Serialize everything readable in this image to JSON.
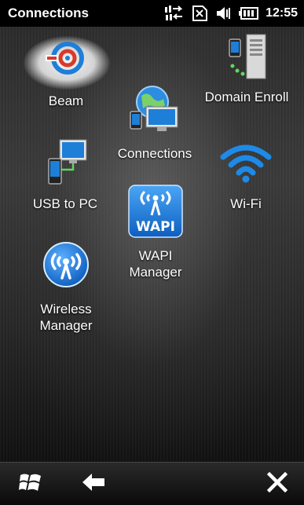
{
  "status_bar": {
    "title": "Connections",
    "time": "12:55",
    "icons": [
      "data-sync-icon",
      "sim-icon",
      "volume-icon",
      "battery-icon"
    ]
  },
  "tiles": {
    "beam": {
      "label": "Beam",
      "icon": "beam-icon"
    },
    "domain_enroll": {
      "label": "Domain Enroll",
      "icon": "domain-enroll-icon"
    },
    "connections": {
      "label": "Connections",
      "icon": "connections-globe-icon"
    },
    "usb_to_pc": {
      "label": "USB to PC",
      "icon": "usb-to-pc-icon"
    },
    "wifi": {
      "label": "Wi-Fi",
      "icon": "wifi-icon"
    },
    "wapi": {
      "label_line1": "WAPI",
      "label_line2": "Manager",
      "icon": "wapi-icon",
      "icon_text": "WAPI"
    },
    "wireless_manager": {
      "label_line1": "Wireless",
      "label_line2": "Manager",
      "icon": "wireless-manager-icon"
    }
  },
  "bottom_bar": {
    "start": "windows-start-icon",
    "back": "back-arrow-icon",
    "close": "close-icon"
  },
  "colors": {
    "accent_blue": "#1e7fd8",
    "beam_red": "#d83a2a",
    "status_bg": "#000000"
  }
}
